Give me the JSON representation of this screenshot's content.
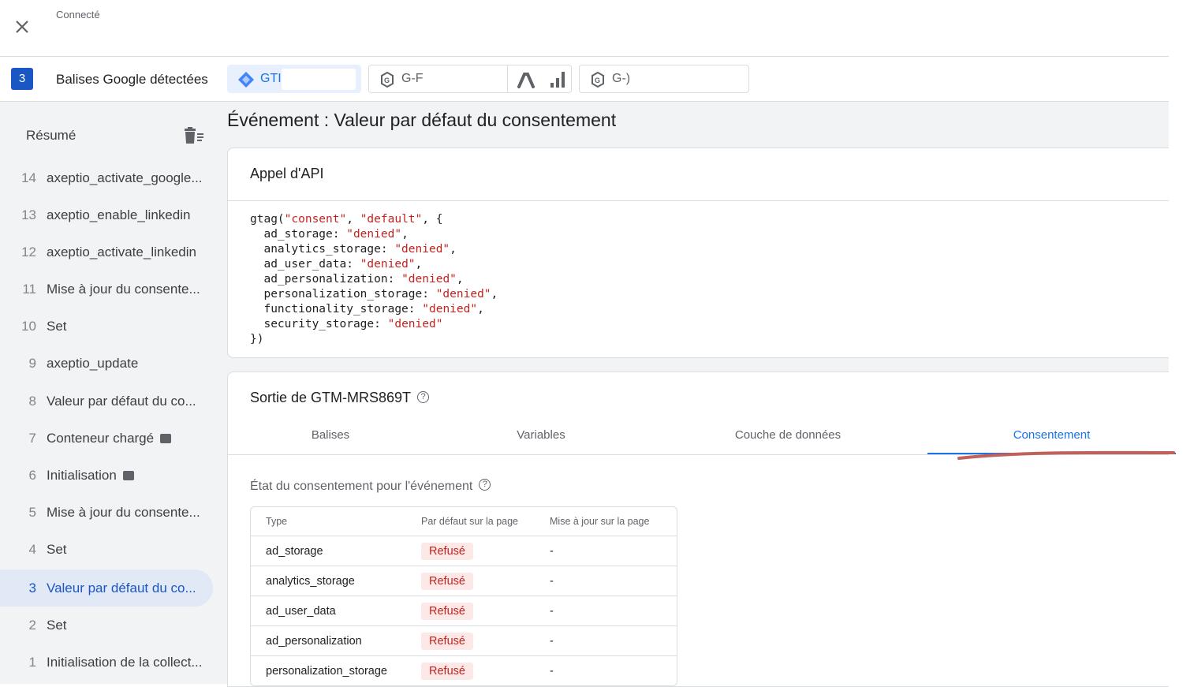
{
  "header": {
    "status": "Connecté"
  },
  "tagbar": {
    "count": "3",
    "label": "Balises Google détectées",
    "chips": [
      {
        "label": "GTI"
      },
      {
        "label": "G-F"
      },
      {
        "label": "G-)"
      }
    ]
  },
  "sidebar": {
    "title": "Résumé",
    "events": [
      {
        "num": "14",
        "label": "axeptio_activate_google..."
      },
      {
        "num": "13",
        "label": "axeptio_enable_linkedin"
      },
      {
        "num": "12",
        "label": "axeptio_activate_linkedin"
      },
      {
        "num": "11",
        "label": "Mise à jour du consente..."
      },
      {
        "num": "10",
        "label": "Set"
      },
      {
        "num": "9",
        "label": "axeptio_update"
      },
      {
        "num": "8",
        "label": "Valeur par défaut du co..."
      },
      {
        "num": "7",
        "label": "Conteneur chargé"
      },
      {
        "num": "6",
        "label": "Initialisation"
      },
      {
        "num": "5",
        "label": "Mise à jour du consente..."
      },
      {
        "num": "4",
        "label": "Set"
      },
      {
        "num": "3",
        "label": "Valeur par défaut du co..."
      },
      {
        "num": "2",
        "label": "Set"
      },
      {
        "num": "1",
        "label": "Initialisation de la collect..."
      }
    ]
  },
  "main": {
    "title": "Événement : Valeur par défaut du consentement",
    "api_card": {
      "title": "Appel d'API",
      "code": {
        "l0a": "gtag(",
        "l0s1": "\"consent\"",
        "l0b": ", ",
        "l0s2": "\"default\"",
        "l0c": ", {",
        "rows": [
          {
            "key": "  ad_storage: ",
            "val": "\"denied\"",
            "end": ","
          },
          {
            "key": "  analytics_storage: ",
            "val": "\"denied\"",
            "end": ","
          },
          {
            "key": "  ad_user_data: ",
            "val": "\"denied\"",
            "end": ","
          },
          {
            "key": "  ad_personalization: ",
            "val": "\"denied\"",
            "end": ","
          },
          {
            "key": "  personalization_storage: ",
            "val": "\"denied\"",
            "end": ","
          },
          {
            "key": "  functionality_storage: ",
            "val": "\"denied\"",
            "end": ","
          },
          {
            "key": "  security_storage: ",
            "val": "\"denied\"",
            "end": ""
          }
        ],
        "close": "})"
      }
    },
    "output_card": {
      "title": "Sortie de GTM-MRS869T",
      "tabs": [
        "Balises",
        "Variables",
        "Couche de données",
        "Consentement"
      ],
      "consent_state_label": "État du consentement pour l'événement",
      "table": {
        "headers": [
          "Type",
          "Par défaut sur la page",
          "Mise à jour sur la page"
        ],
        "rows": [
          {
            "type": "ad_storage",
            "default": "Refusé",
            "update": "-"
          },
          {
            "type": "analytics_storage",
            "default": "Refusé",
            "update": "-"
          },
          {
            "type": "ad_user_data",
            "default": "Refusé",
            "update": "-"
          },
          {
            "type": "ad_personalization",
            "default": "Refusé",
            "update": "-"
          },
          {
            "type": "personalization_storage",
            "default": "Refusé",
            "update": "-"
          }
        ]
      }
    }
  },
  "colors": {
    "accent": "#1a73e8",
    "badge": "#1a56c4",
    "denied_bg": "#fce8e6",
    "denied_text": "#c5221f",
    "annotation": "#c0625a"
  }
}
